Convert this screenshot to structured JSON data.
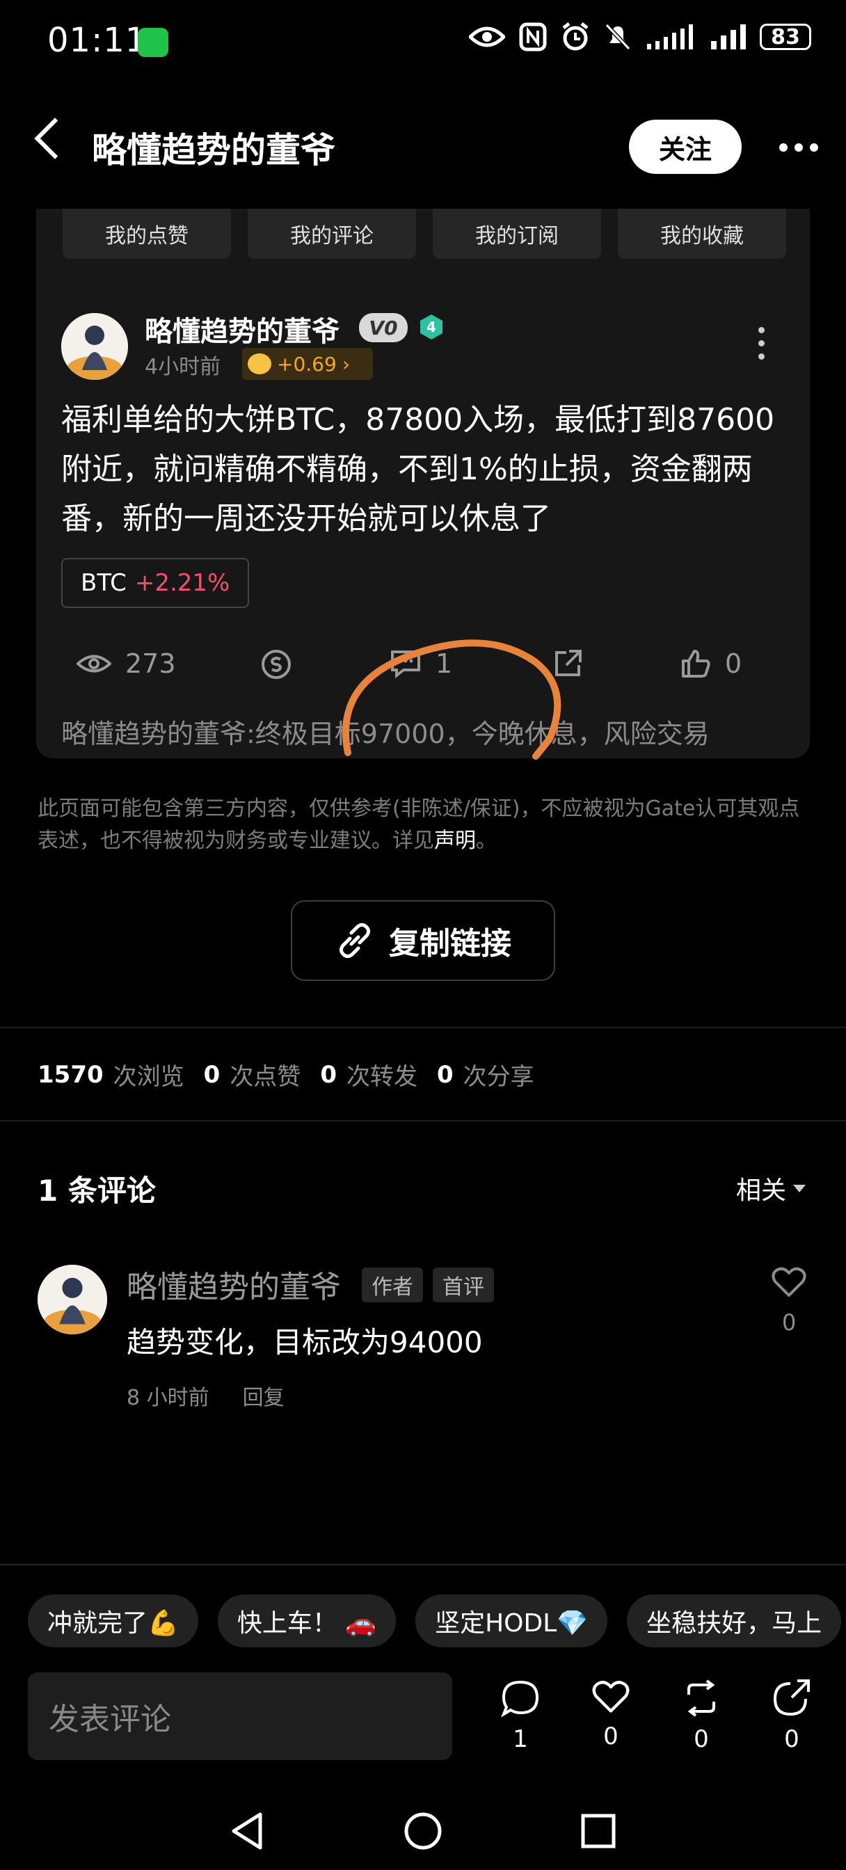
{
  "status_bar": {
    "time": "01:11",
    "battery": "83"
  },
  "header": {
    "title": "略懂趋势的董爷",
    "follow_label": "关注"
  },
  "tabs": [
    "我的点赞",
    "我的评论",
    "我的订阅",
    "我的收藏"
  ],
  "post": {
    "author": "略懂趋势的董爷",
    "vip_badge": "V0",
    "level": "4",
    "time": "4小时前",
    "earnings": "+0.69",
    "content": "福利单给的大饼BTC，87800入场，最低打到87600附近，就问精确不精确，不到1%的止损，资金翻两番，新的一周还没开始就可以休息了",
    "tag": {
      "symbol": "BTC",
      "change": "+2.21%"
    },
    "views": "273",
    "comments": "1",
    "likes": "0",
    "first_comment": "略懂趋势的董爷:终极目标97000，今晚休息，风险交易"
  },
  "disclaimer": {
    "text": "此页面可能包含第三方内容，仅供参考(非陈述/保证)，不应被视为Gate认可其观点表述，也不得被视为财务或专业建议。详见",
    "link": "声明",
    "end": "。"
  },
  "copy_link_label": "复制链接",
  "metrics": {
    "views": "1570",
    "views_label": "次浏览",
    "likes": "0",
    "likes_label": "次点赞",
    "reposts": "0",
    "reposts_label": "次转发",
    "shares": "0",
    "shares_label": "次分享"
  },
  "comments": {
    "count_label": "1 条评论",
    "sort_label": "相关",
    "items": [
      {
        "author": "略懂趋势的董爷",
        "badges": [
          "作者",
          "首评"
        ],
        "text": "趋势变化，目标改为94000",
        "time": "8 小时前",
        "reply_label": "回复",
        "likes": "0"
      }
    ]
  },
  "quick_replies": [
    "冲就完了💪",
    "快上车！ 🚗",
    "坚定HODL💎",
    "坐稳扶好，马上"
  ],
  "bottom_bar": {
    "input_placeholder": "发表评论",
    "comment_count": "1",
    "like_count": "0",
    "repost_count": "0",
    "share_count": "0"
  },
  "colors": {
    "accent_red": "#f2506a",
    "gold": "#f5a623",
    "annotation_orange": "#e8833a"
  }
}
